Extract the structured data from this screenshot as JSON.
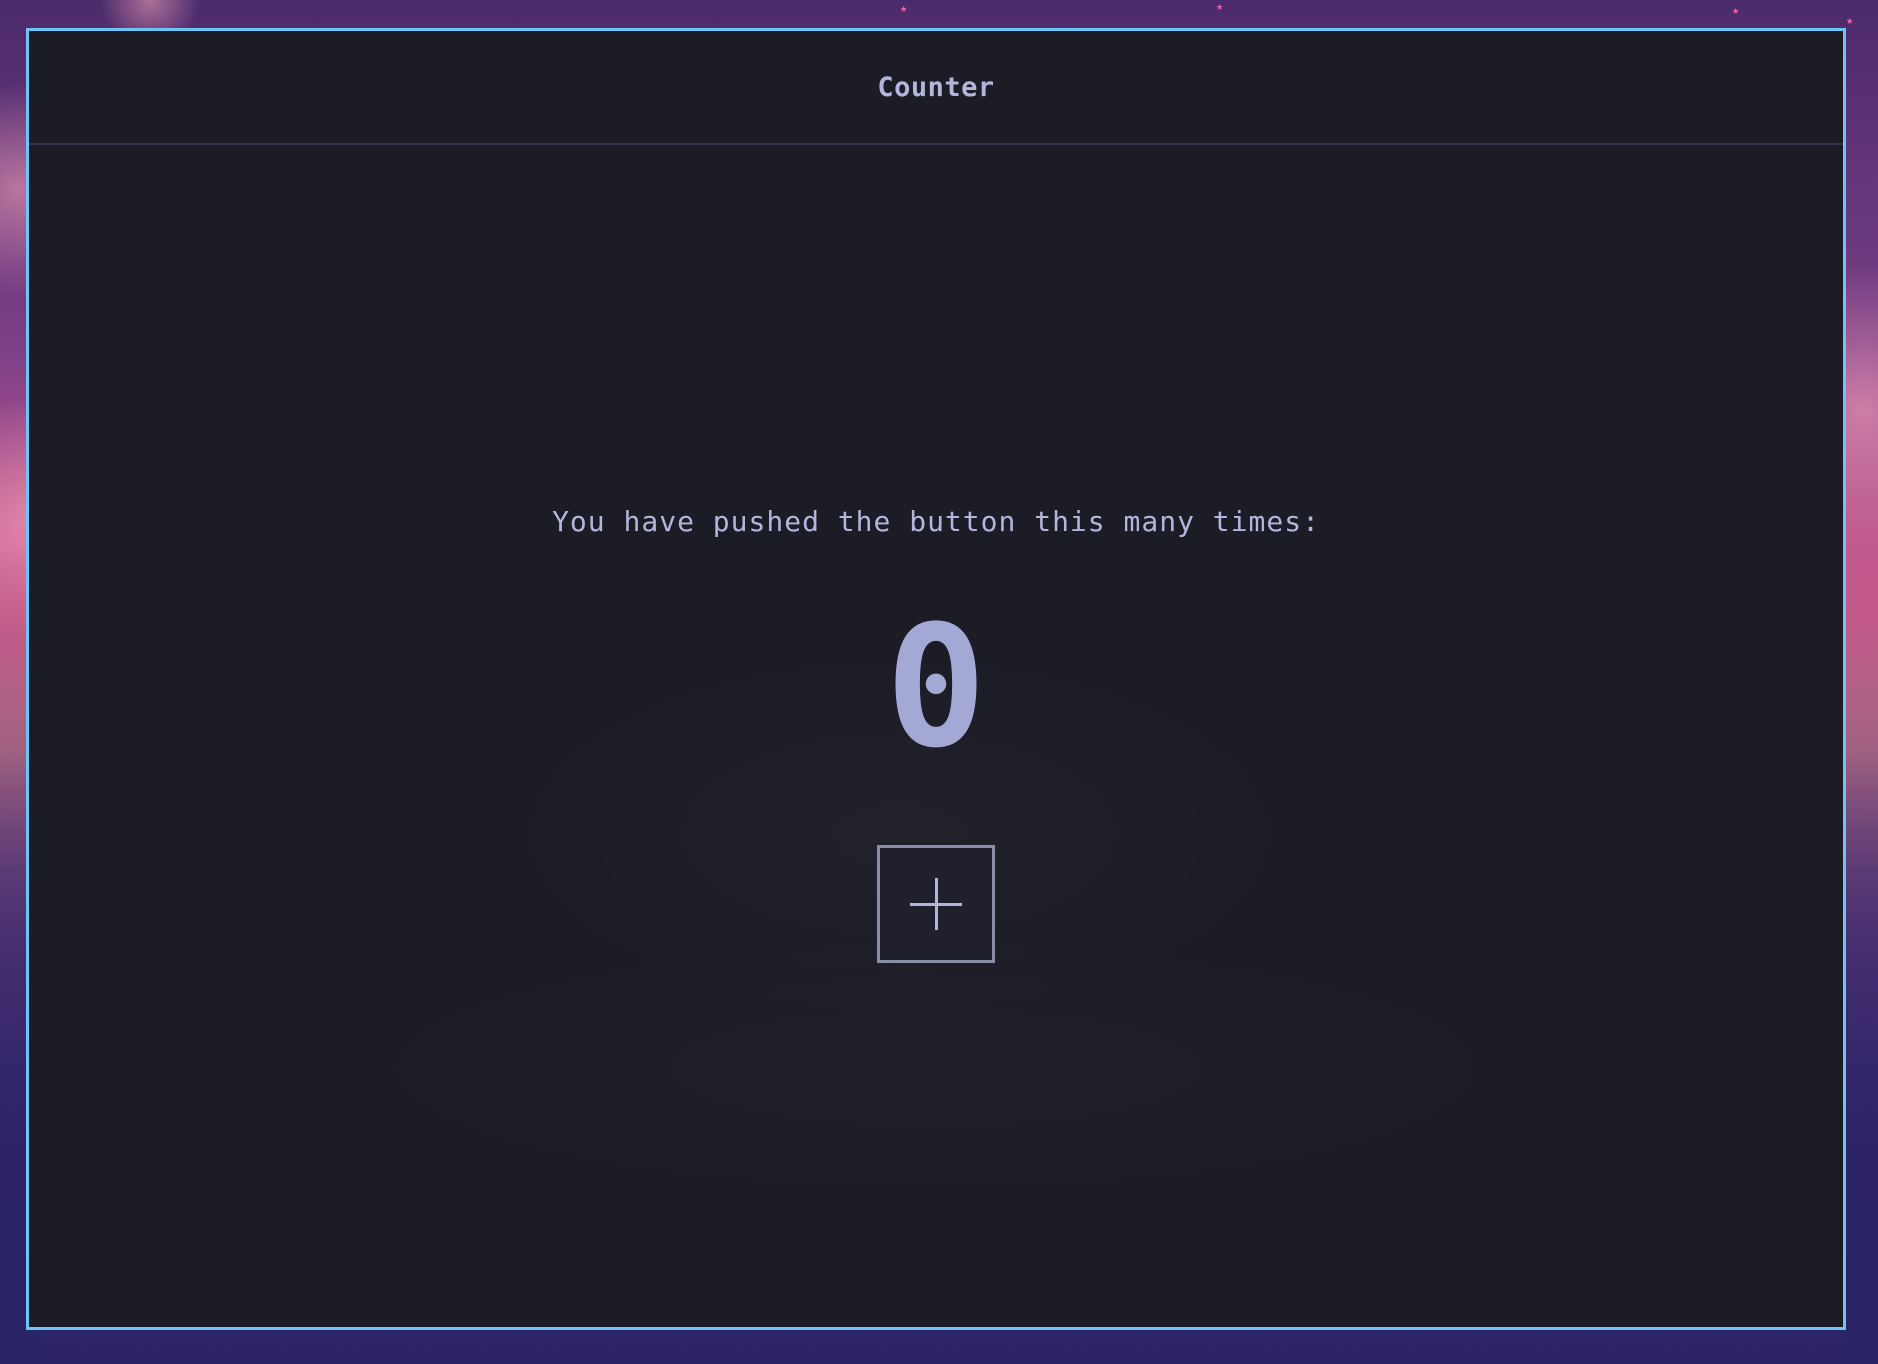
{
  "app": {
    "title": "Counter"
  },
  "main": {
    "message": "You have pushed the button this many times:",
    "count": "0"
  },
  "actions": {
    "increment_icon": "plus-icon"
  },
  "colors": {
    "window_border": "#6fc3f5",
    "window_background": "#1c1c26",
    "text": "#b3b6dc",
    "counter_text": "#a3a8d4",
    "button_border": "#8a8da8"
  }
}
